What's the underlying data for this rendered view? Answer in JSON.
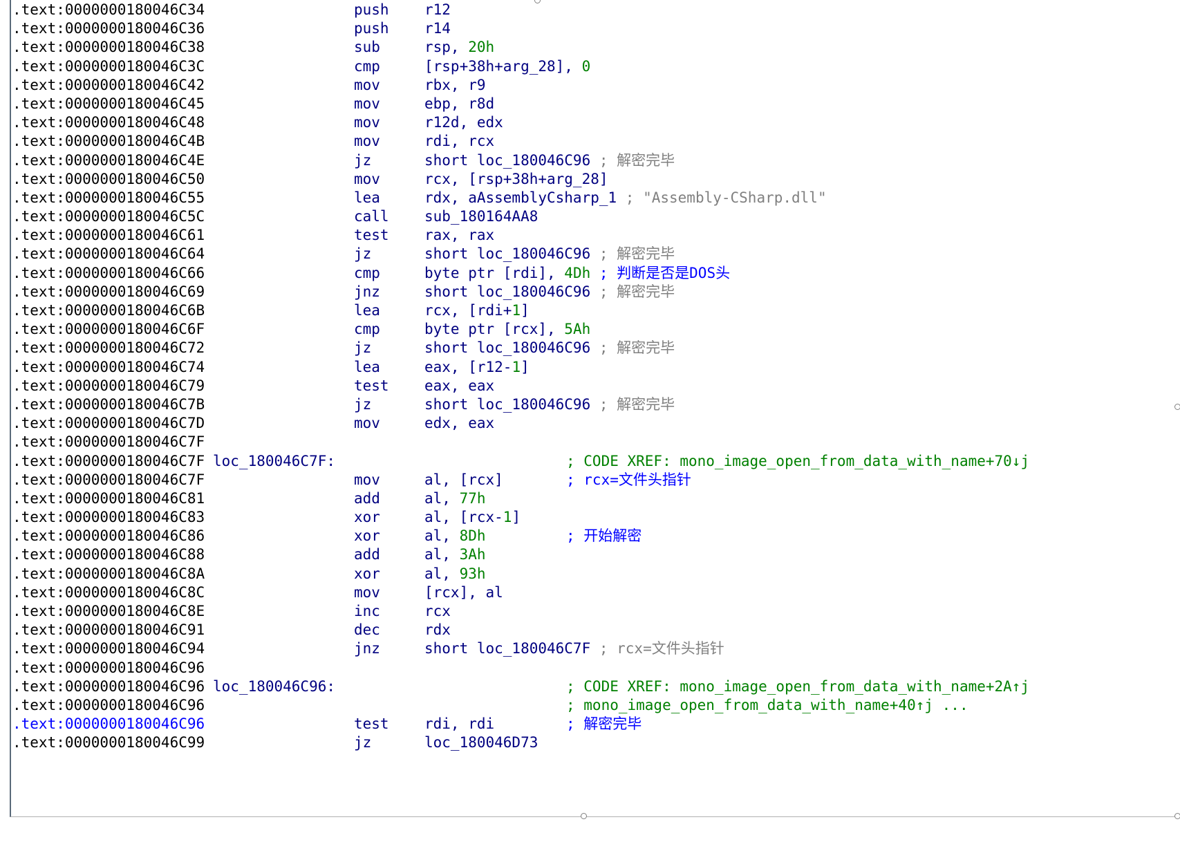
{
  "listing": [
    {
      "addr": ".text:0000000180046C34",
      "mnem": "push",
      "ops": [
        {
          "t": "r12",
          "c": "op"
        }
      ]
    },
    {
      "addr": ".text:0000000180046C36",
      "mnem": "push",
      "ops": [
        {
          "t": "r14",
          "c": "op"
        }
      ]
    },
    {
      "addr": ".text:0000000180046C38",
      "mnem": "sub",
      "ops": [
        {
          "t": "rsp, ",
          "c": "op"
        },
        {
          "t": "20h",
          "c": "num"
        }
      ]
    },
    {
      "addr": ".text:0000000180046C3C",
      "mnem": "cmp",
      "ops": [
        {
          "t": "[rsp+38h+arg_28], ",
          "c": "op"
        },
        {
          "t": "0",
          "c": "num"
        }
      ]
    },
    {
      "addr": ".text:0000000180046C42",
      "mnem": "mov",
      "ops": [
        {
          "t": "rbx, r9",
          "c": "op"
        }
      ]
    },
    {
      "addr": ".text:0000000180046C45",
      "mnem": "mov",
      "ops": [
        {
          "t": "ebp, r8d",
          "c": "op"
        }
      ]
    },
    {
      "addr": ".text:0000000180046C48",
      "mnem": "mov",
      "ops": [
        {
          "t": "r12d, edx",
          "c": "op"
        }
      ]
    },
    {
      "addr": ".text:0000000180046C4B",
      "mnem": "mov",
      "ops": [
        {
          "t": "rdi, rcx",
          "c": "op"
        }
      ]
    },
    {
      "addr": ".text:0000000180046C4E",
      "mnem": "jz",
      "ops": [
        {
          "t": "short loc_180046C96",
          "c": "op"
        },
        {
          "t": " ; 解密完毕",
          "c": "cg"
        }
      ]
    },
    {
      "addr": ".text:0000000180046C50",
      "mnem": "mov",
      "ops": [
        {
          "t": "rcx, [rsp+38h+arg_28]",
          "c": "op"
        }
      ]
    },
    {
      "addr": ".text:0000000180046C55",
      "mnem": "lea",
      "ops": [
        {
          "t": "rdx, aAssemblyCsharp_1",
          "c": "op"
        },
        {
          "t": " ; \"Assembly-CSharp.dll\"",
          "c": "cg"
        }
      ]
    },
    {
      "addr": ".text:0000000180046C5C",
      "mnem": "call",
      "ops": [
        {
          "t": "sub_180164AA8",
          "c": "op"
        }
      ]
    },
    {
      "addr": ".text:0000000180046C61",
      "mnem": "test",
      "ops": [
        {
          "t": "rax, rax",
          "c": "op"
        }
      ]
    },
    {
      "addr": ".text:0000000180046C64",
      "mnem": "jz",
      "ops": [
        {
          "t": "short loc_180046C96",
          "c": "op"
        },
        {
          "t": " ; 解密完毕",
          "c": "cg"
        }
      ]
    },
    {
      "addr": ".text:0000000180046C66",
      "mnem": "cmp",
      "ops": [
        {
          "t": "byte ptr [rdi], ",
          "c": "op"
        },
        {
          "t": "4Dh",
          "c": "num"
        },
        {
          "t": " ; 判断是否是DOS头",
          "c": "cb"
        }
      ]
    },
    {
      "addr": ".text:0000000180046C69",
      "mnem": "jnz",
      "ops": [
        {
          "t": "short loc_180046C96",
          "c": "op"
        },
        {
          "t": " ; 解密完毕",
          "c": "cg"
        }
      ]
    },
    {
      "addr": ".text:0000000180046C6B",
      "mnem": "lea",
      "ops": [
        {
          "t": "rcx, [rdi+",
          "c": "op"
        },
        {
          "t": "1",
          "c": "num"
        },
        {
          "t": "]",
          "c": "op"
        }
      ]
    },
    {
      "addr": ".text:0000000180046C6F",
      "mnem": "cmp",
      "ops": [
        {
          "t": "byte ptr [rcx], ",
          "c": "op"
        },
        {
          "t": "5Ah",
          "c": "num"
        }
      ]
    },
    {
      "addr": ".text:0000000180046C72",
      "mnem": "jz",
      "ops": [
        {
          "t": "short loc_180046C96",
          "c": "op"
        },
        {
          "t": " ; 解密完毕",
          "c": "cg"
        }
      ]
    },
    {
      "addr": ".text:0000000180046C74",
      "mnem": "lea",
      "ops": [
        {
          "t": "eax, [r12-",
          "c": "op"
        },
        {
          "t": "1",
          "c": "num"
        },
        {
          "t": "]",
          "c": "op"
        }
      ]
    },
    {
      "addr": ".text:0000000180046C79",
      "mnem": "test",
      "ops": [
        {
          "t": "eax, eax",
          "c": "op"
        }
      ]
    },
    {
      "addr": ".text:0000000180046C7B",
      "mnem": "jz",
      "ops": [
        {
          "t": "short loc_180046C96",
          "c": "op"
        },
        {
          "t": " ; 解密完毕",
          "c": "cg"
        }
      ]
    },
    {
      "addr": ".text:0000000180046C7D",
      "mnem": "mov",
      "ops": [
        {
          "t": "edx, eax",
          "c": "op"
        }
      ]
    },
    {
      "addr": ".text:0000000180046C7F"
    },
    {
      "addr": ".text:0000000180046C7F",
      "label": "loc_180046C7F:",
      "xref": "; CODE XREF: mono_image_open_from_data_with_name+70↓j"
    },
    {
      "addr": ".text:0000000180046C7F",
      "mnem": "mov",
      "ops": [
        {
          "t": "al, [rcx]",
          "c": "op"
        }
      ],
      "cmt": "; rcx=文件头指针"
    },
    {
      "addr": ".text:0000000180046C81",
      "mnem": "add",
      "ops": [
        {
          "t": "al, ",
          "c": "op"
        },
        {
          "t": "77h",
          "c": "num"
        }
      ]
    },
    {
      "addr": ".text:0000000180046C83",
      "mnem": "xor",
      "ops": [
        {
          "t": "al, [rcx-",
          "c": "op"
        },
        {
          "t": "1",
          "c": "num"
        },
        {
          "t": "]",
          "c": "op"
        }
      ]
    },
    {
      "addr": ".text:0000000180046C86",
      "mnem": "xor",
      "ops": [
        {
          "t": "al, ",
          "c": "op"
        },
        {
          "t": "8Dh",
          "c": "num"
        }
      ],
      "cmt": "; 开始解密"
    },
    {
      "addr": ".text:0000000180046C88",
      "mnem": "add",
      "ops": [
        {
          "t": "al, ",
          "c": "op"
        },
        {
          "t": "3Ah",
          "c": "num"
        }
      ]
    },
    {
      "addr": ".text:0000000180046C8A",
      "mnem": "xor",
      "ops": [
        {
          "t": "al, ",
          "c": "op"
        },
        {
          "t": "93h",
          "c": "num"
        }
      ]
    },
    {
      "addr": ".text:0000000180046C8C",
      "mnem": "mov",
      "ops": [
        {
          "t": "[rcx], al",
          "c": "op"
        }
      ]
    },
    {
      "addr": ".text:0000000180046C8E",
      "mnem": "inc",
      "ops": [
        {
          "t": "rcx",
          "c": "op"
        }
      ]
    },
    {
      "addr": ".text:0000000180046C91",
      "mnem": "dec",
      "ops": [
        {
          "t": "rdx",
          "c": "op"
        }
      ]
    },
    {
      "addr": ".text:0000000180046C94",
      "mnem": "jnz",
      "ops": [
        {
          "t": "short loc_180046C7F",
          "c": "op"
        },
        {
          "t": " ; rcx=文件头指针",
          "c": "cg"
        }
      ]
    },
    {
      "addr": ".text:0000000180046C96"
    },
    {
      "addr": ".text:0000000180046C96",
      "label": "loc_180046C96:",
      "xref": "; CODE XREF: mono_image_open_from_data_with_name+2A↑j"
    },
    {
      "addr": ".text:0000000180046C96",
      "xref": "; mono_image_open_from_data_with_name+40↑j ..."
    },
    {
      "addr": ".text:0000000180046C96",
      "mnem": "test",
      "ops": [
        {
          "t": "rdi, rdi",
          "c": "op"
        }
      ],
      "cmt": "; 解密完毕",
      "current": true
    },
    {
      "addr": ".text:0000000180046C99",
      "mnem": "jz",
      "ops": [
        {
          "t": "loc_180046D73",
          "c": "op"
        }
      ]
    }
  ]
}
